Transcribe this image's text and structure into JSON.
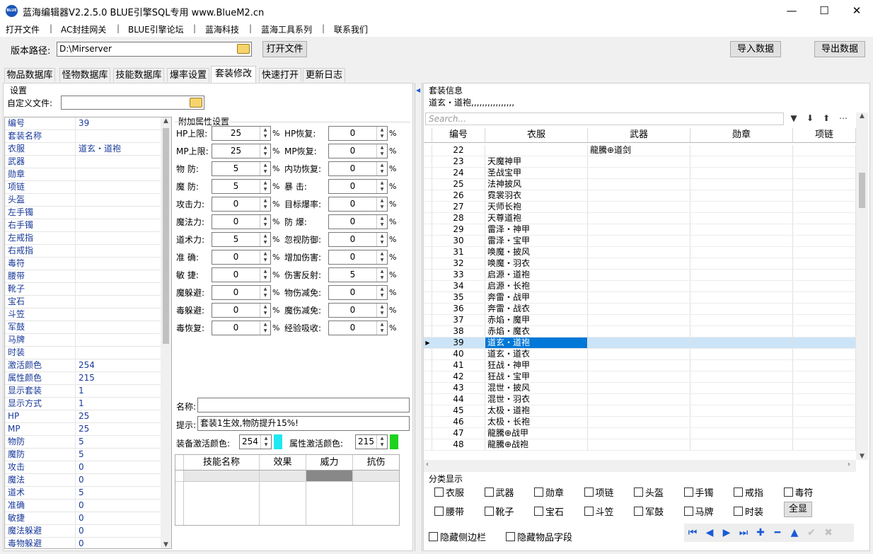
{
  "window": {
    "title": "蓝海编辑器V2.2.5.0  BLUE引擎SQL专用   www.BlueM2.cn",
    "icon_text": "BLUE",
    "minimize": "—",
    "maximize": "☐",
    "close": "✕"
  },
  "menu": [
    "打开文件",
    "AC封挂网关",
    "BLUE引擎论坛",
    "蓝海科技",
    "蓝海工具系列",
    "联系我们"
  ],
  "menu_sep": "|",
  "top": {
    "version_label": "版本路径:",
    "version_path": "D:\\Mirserver",
    "open_file": "打开文件",
    "import": "导入数据",
    "export": "导出数据"
  },
  "tabs": [
    "物品数据库",
    "怪物数据库",
    "技能数据库",
    "爆率设置",
    "套装修改",
    "快速打开",
    "更新日志"
  ],
  "left": {
    "settings_title": "设置",
    "custom_file_label": "自定义文件:",
    "props": [
      {
        "k": "编号",
        "v": "39"
      },
      {
        "k": "套装名称",
        "v": ""
      },
      {
        "k": "衣服",
        "v": "道玄・道袍"
      },
      {
        "k": "武器",
        "v": ""
      },
      {
        "k": "勋章",
        "v": ""
      },
      {
        "k": "项链",
        "v": ""
      },
      {
        "k": "头盔",
        "v": ""
      },
      {
        "k": "左手镯",
        "v": ""
      },
      {
        "k": "右手镯",
        "v": ""
      },
      {
        "k": "左戒指",
        "v": ""
      },
      {
        "k": "右戒指",
        "v": ""
      },
      {
        "k": "毒符",
        "v": ""
      },
      {
        "k": "腰带",
        "v": ""
      },
      {
        "k": "靴子",
        "v": ""
      },
      {
        "k": "宝石",
        "v": ""
      },
      {
        "k": "斗笠",
        "v": ""
      },
      {
        "k": "军鼓",
        "v": ""
      },
      {
        "k": "马牌",
        "v": ""
      },
      {
        "k": "时装",
        "v": ""
      },
      {
        "k": "激活颜色",
        "v": "254"
      },
      {
        "k": "属性颜色",
        "v": "215"
      },
      {
        "k": "显示套装",
        "v": "1"
      },
      {
        "k": "显示方式",
        "v": "1"
      },
      {
        "k": "HP",
        "v": "25"
      },
      {
        "k": "MP",
        "v": "25"
      },
      {
        "k": "物防",
        "v": "5"
      },
      {
        "k": "魔防",
        "v": "5"
      },
      {
        "k": "攻击",
        "v": "0"
      },
      {
        "k": "魔法",
        "v": "0"
      },
      {
        "k": "道术",
        "v": "5"
      },
      {
        "k": "准确",
        "v": "0"
      },
      {
        "k": "敏捷",
        "v": "0"
      },
      {
        "k": "魔法躲避",
        "v": "0"
      },
      {
        "k": "毒物躲避",
        "v": "0"
      }
    ]
  },
  "attrs": {
    "title": "附加属性设置",
    "percent": "%",
    "left": [
      {
        "label": "HP上限:",
        "value": "25"
      },
      {
        "label": "MP上限:",
        "value": "25"
      },
      {
        "label": "物  防:",
        "value": "5"
      },
      {
        "label": "魔  防:",
        "value": "5"
      },
      {
        "label": "攻击力:",
        "value": "0"
      },
      {
        "label": "魔法力:",
        "value": "0"
      },
      {
        "label": "道术力:",
        "value": "5"
      },
      {
        "label": "准  确:",
        "value": "0"
      },
      {
        "label": "敏  捷:",
        "value": "0"
      },
      {
        "label": "魔躲避:",
        "value": "0"
      },
      {
        "label": "毒躲避:",
        "value": "0"
      },
      {
        "label": "毒恢复:",
        "value": "0"
      }
    ],
    "right": [
      {
        "label": "HP恢复:",
        "value": "0"
      },
      {
        "label": "MP恢复:",
        "value": "0"
      },
      {
        "label": "内功恢复:",
        "value": "0"
      },
      {
        "label": "暴  击:",
        "value": "0"
      },
      {
        "label": "目标爆率:",
        "value": "0"
      },
      {
        "label": "防  爆:",
        "value": "0"
      },
      {
        "label": "忽视防御:",
        "value": "0"
      },
      {
        "label": "增加伤害:",
        "value": "0"
      },
      {
        "label": "伤害反射:",
        "value": "5"
      },
      {
        "label": "物伤减免:",
        "value": "0"
      },
      {
        "label": "魔伤减免:",
        "value": "0"
      },
      {
        "label": "经验吸收:",
        "value": "0"
      }
    ],
    "name_label": "名称:",
    "name_value": "",
    "hint_label": "提示:",
    "hint_value": "套装1生效,物防提升15%!",
    "equip_color_label": "装备激活颜色:",
    "equip_color_value": "254",
    "equip_color_swatch": "#1ee8f0",
    "attr_color_label": "属性激活颜色:",
    "attr_color_value": "215",
    "attr_color_swatch": "#1ed21e",
    "skill_cols": [
      "技能名称",
      "效果",
      "威力",
      "抗伤"
    ]
  },
  "right": {
    "info_title": "套装信息",
    "info_text": "道玄・道袍,,,,,,,,,,,,,,,,",
    "search_placeholder": "Search...",
    "toolbar": [
      "▼",
      "⬇",
      "⬆",
      "⋯"
    ],
    "columns": [
      "编号",
      "衣服",
      "武器",
      "勋章",
      "项链"
    ],
    "rows": [
      {
        "id": "22",
        "cloth": "",
        "weapon": "龍騰⊕道剑"
      },
      {
        "id": "23",
        "cloth": "天魔神甲",
        "weapon": ""
      },
      {
        "id": "24",
        "cloth": "圣战宝甲",
        "weapon": ""
      },
      {
        "id": "25",
        "cloth": "法神披风",
        "weapon": ""
      },
      {
        "id": "26",
        "cloth": "霓裳羽衣",
        "weapon": ""
      },
      {
        "id": "27",
        "cloth": "天师长袍",
        "weapon": ""
      },
      {
        "id": "28",
        "cloth": "天尊道袍",
        "weapon": ""
      },
      {
        "id": "29",
        "cloth": "雷泽・神甲",
        "weapon": ""
      },
      {
        "id": "30",
        "cloth": "雷泽・宝甲",
        "weapon": ""
      },
      {
        "id": "31",
        "cloth": "唤魔・披风",
        "weapon": ""
      },
      {
        "id": "32",
        "cloth": "唤魔・羽衣",
        "weapon": ""
      },
      {
        "id": "33",
        "cloth": "启源・道袍",
        "weapon": ""
      },
      {
        "id": "34",
        "cloth": "启源・长袍",
        "weapon": ""
      },
      {
        "id": "35",
        "cloth": "奔雷・战甲",
        "weapon": ""
      },
      {
        "id": "36",
        "cloth": "奔雷・战衣",
        "weapon": ""
      },
      {
        "id": "37",
        "cloth": "赤焰・魔甲",
        "weapon": ""
      },
      {
        "id": "38",
        "cloth": "赤焰・魔衣",
        "weapon": ""
      },
      {
        "id": "39",
        "cloth": "道玄・道袍",
        "weapon": "",
        "selected": true
      },
      {
        "id": "40",
        "cloth": "道玄・道衣",
        "weapon": ""
      },
      {
        "id": "41",
        "cloth": "狂战・神甲",
        "weapon": ""
      },
      {
        "id": "42",
        "cloth": "狂战・宝甲",
        "weapon": ""
      },
      {
        "id": "43",
        "cloth": "混世・披风",
        "weapon": ""
      },
      {
        "id": "44",
        "cloth": "混世・羽衣",
        "weapon": ""
      },
      {
        "id": "45",
        "cloth": "太极・道袍",
        "weapon": ""
      },
      {
        "id": "46",
        "cloth": "太极・长袍",
        "weapon": ""
      },
      {
        "id": "47",
        "cloth": "龍騰⊕战甲",
        "weapon": ""
      },
      {
        "id": "48",
        "cloth": "龍騰⊕战袍",
        "weapon": ""
      }
    ],
    "category_title": "分类显示",
    "categories_row1": [
      "衣服",
      "武器",
      "勋章",
      "项链",
      "头盔",
      "手镯",
      "戒指",
      "毒符"
    ],
    "categories_row2": [
      "腰带",
      "靴子",
      "宝石",
      "斗笠",
      "军鼓",
      "马牌",
      "时装"
    ],
    "show_all": "全显",
    "hide_sidebar": "隐藏侧边栏",
    "hide_fields": "隐藏物品字段",
    "nav_icons": [
      "first-icon",
      "prev-icon",
      "next-icon",
      "last-icon",
      "add-icon",
      "delete-icon",
      "up-icon",
      "confirm-icon",
      "cancel-icon"
    ],
    "nav_glyphs": [
      "⏮",
      "◀",
      "▶",
      "⏭",
      "✚",
      "━",
      "▲",
      "✔",
      "✖"
    ]
  }
}
